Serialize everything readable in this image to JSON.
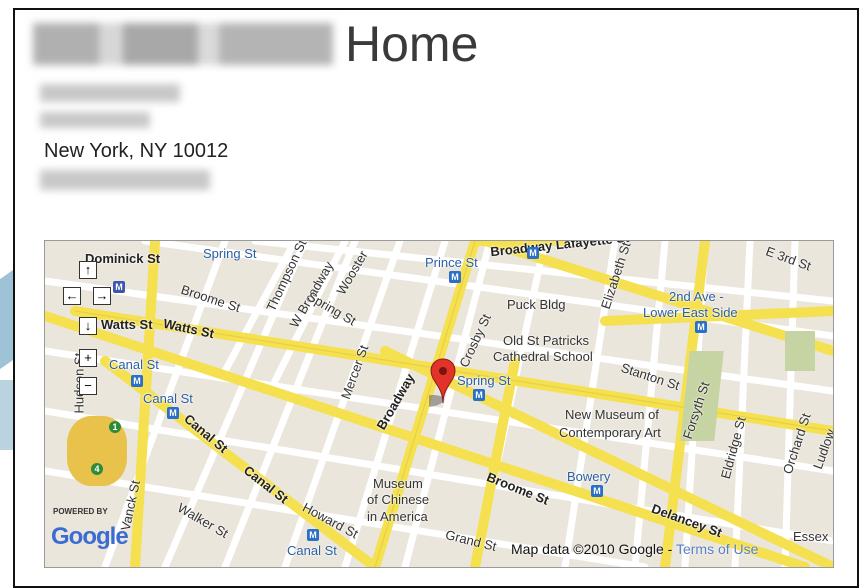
{
  "header": {
    "title": "Home"
  },
  "address": {
    "city_line": "New York, NY 10012"
  },
  "map": {
    "streets": [
      {
        "name": "Dominick St"
      },
      {
        "name": "Spring St"
      },
      {
        "name": "Thompson St"
      },
      {
        "name": "W Broadway"
      },
      {
        "name": "Wooster"
      },
      {
        "name": "Prince St"
      },
      {
        "name": "Broadway Lafayette St"
      },
      {
        "name": "Elizabeth St"
      },
      {
        "name": "E 3rd St"
      },
      {
        "name": "Broome St"
      },
      {
        "name": "Spring St"
      },
      {
        "name": "Crosby St"
      },
      {
        "name": "Puck Bldg"
      },
      {
        "name": "2nd Ave -"
      },
      {
        "name": "Lower East Side"
      },
      {
        "name": "Watts St"
      },
      {
        "name": "Watts St"
      },
      {
        "name": "Old St Patricks"
      },
      {
        "name": "Cathedral School"
      },
      {
        "name": "Mercer St"
      },
      {
        "name": "Canal St"
      },
      {
        "name": "Spring St"
      },
      {
        "name": "Stanton St"
      },
      {
        "name": "Broadway"
      },
      {
        "name": "Canal St"
      },
      {
        "name": "New Museum of"
      },
      {
        "name": "Contemporary Art"
      },
      {
        "name": "Forsyth St"
      },
      {
        "name": "Eldridge St"
      },
      {
        "name": "Orchard St"
      },
      {
        "name": "Ludlow"
      },
      {
        "name": "Canal St"
      },
      {
        "name": "Hudson St"
      },
      {
        "name": "Canal St"
      },
      {
        "name": "Bowery"
      },
      {
        "name": "Museum"
      },
      {
        "name": "of Chinese"
      },
      {
        "name": "in America"
      },
      {
        "name": "Broome St"
      },
      {
        "name": "Vanck St"
      },
      {
        "name": "Howard St"
      },
      {
        "name": "Walker St"
      },
      {
        "name": "Canal St"
      },
      {
        "name": "Grand St"
      },
      {
        "name": "Delancey St"
      },
      {
        "name": "Essex St"
      }
    ],
    "controls": {
      "up": "↑",
      "left": "←",
      "right": "→",
      "down": "↓",
      "zoom_in": "+",
      "zoom_out": "−"
    },
    "powered_by": "POWERED BY",
    "google": "Google",
    "attribution": "Map data ©2010 Google -",
    "terms": "Terms of Use",
    "metro_glyph": "M",
    "route_badges": [
      "1",
      "4"
    ],
    "colors": {
      "major_road": "#f5e04f",
      "minor_road": "#ffffff",
      "land": "#ebe6dc",
      "metro": "#2a6fc9",
      "pin": "#e2332a"
    }
  }
}
